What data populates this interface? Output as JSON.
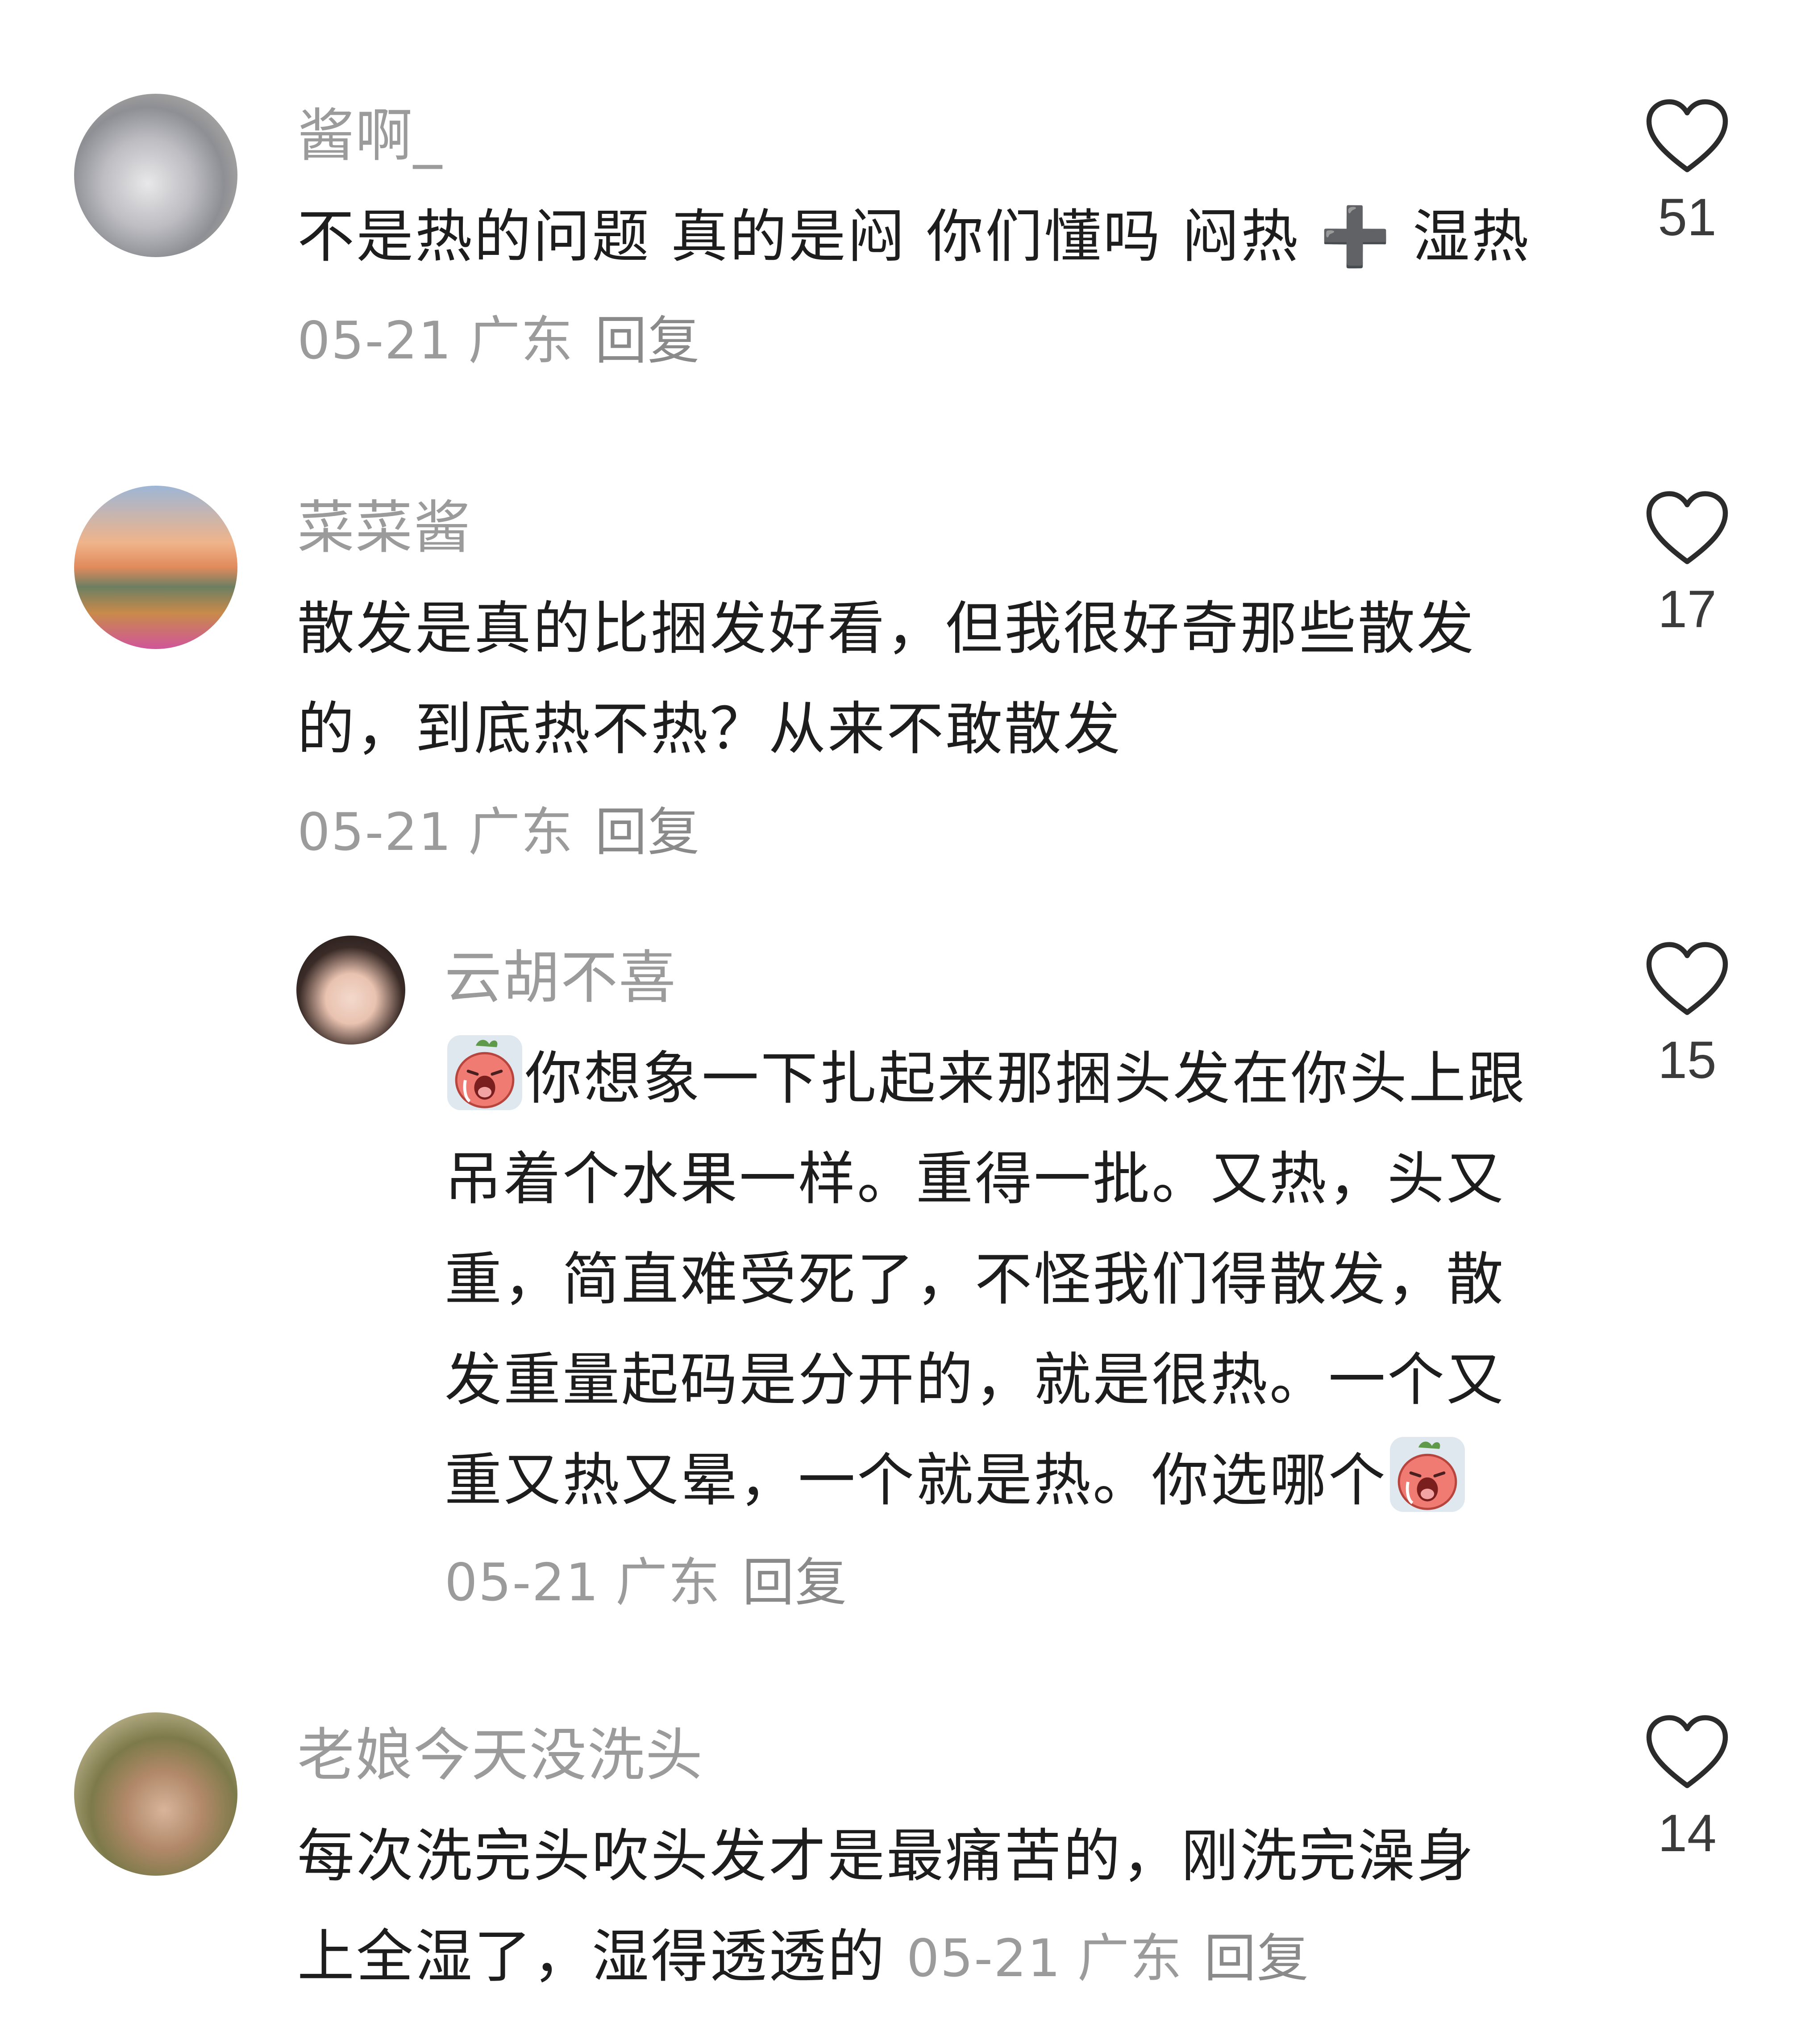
{
  "comments": [
    {
      "author": "酱啊_",
      "text": "不是热的问题 真的是闷 你们懂吗 闷热 ➕ 湿热",
      "date": "05-21",
      "location": "广东",
      "reply_label": "回复",
      "likes": "51"
    },
    {
      "author": "菜菜酱",
      "text": "散发是真的比捆发好看，但我很好奇那些散发的，到底热不热？从来不敢散发",
      "date": "05-21",
      "location": "广东",
      "reply_label": "回复",
      "likes": "17"
    },
    {
      "author": "云胡不喜",
      "text_part1": "你想象一下扎起来那捆头发在你头上跟吊着个水果一样。重得一批。又热，头又重，简直难受死了，不怪我们得散发，散发重量起码是分开的，就是很热。一个又重又热又晕，一个就是热。你选哪个",
      "date": "05-21",
      "location": "广东",
      "reply_label": "回复",
      "likes": "15",
      "emoji_icon": "crying-face-emoji-icon"
    },
    {
      "author": "老娘今天没洗头",
      "text": "每次洗完头吹头发才是最痛苦的，刚洗完澡身上全湿了，湿得透透的",
      "date": "05-21",
      "location": "广东",
      "reply_label": "回复",
      "likes": "14"
    }
  ],
  "icons": {
    "like": "heart-outline-icon"
  },
  "colors": {
    "author": "#9b9b9b",
    "text": "#1d1d1d",
    "meta": "#9b9b9b"
  }
}
